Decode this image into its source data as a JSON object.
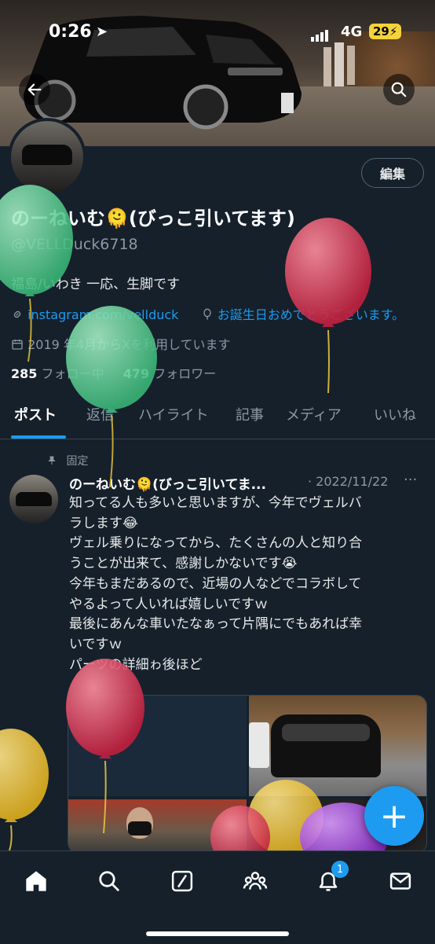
{
  "status_bar": {
    "time": "0:26",
    "network": "4G",
    "battery": "29"
  },
  "header": {
    "back_icon": "arrow-left-icon",
    "search_icon": "search-icon"
  },
  "profile": {
    "edit_label": "編集",
    "display_name": "のーねいむ🫠(びっこ引いてます)",
    "handle": "@VELLDuck6718",
    "bio": "福島/いわき 一応、生脚です",
    "link_text": "instagram.com/vellduck",
    "birthday_text": "お誕生日おめでとうございます。",
    "joined_text": "2019 年4月からXを利用しています",
    "following_count": "285",
    "following_label": "フォロー中",
    "followers_count": "479",
    "followers_label": "フォロワー"
  },
  "tabs": [
    {
      "label": "ポスト",
      "active": true
    },
    {
      "label": "返信"
    },
    {
      "label": "ハイライト"
    },
    {
      "label": "記事"
    },
    {
      "label": "メディア"
    },
    {
      "label": "いいね"
    }
  ],
  "pinned_post": {
    "pinned_label": "固定",
    "author_name": "のーねいむ🫠(びっこ引いてま...",
    "date": "· 2022/11/22",
    "more": "···",
    "lines": [
      "知ってる人も多いと思いますが、今年でヴェルバ",
      "ラします😂",
      "ヴェル乗りになってから、たくさんの人と知り合",
      "うことが出来て、感謝しかないです😭",
      "今年もまだあるので、近場の人などでコラボして",
      "やるよって人いれば嬉しいですｗ",
      "最後にあんな車いたなぁって片隅にでもあれば幸",
      "いですｗ",
      "パーツの詳細ゎ後ほど"
    ]
  },
  "fab_label": "+",
  "bottom_nav": {
    "notification_badge": "1"
  },
  "colors": {
    "background": "#15202b",
    "accent": "#1d9bf0",
    "balloon_green": "#4cc98a",
    "balloon_red": "#d8324f",
    "balloon_yellow": "#f3c531",
    "balloon_purple": "#9a3bd6"
  }
}
